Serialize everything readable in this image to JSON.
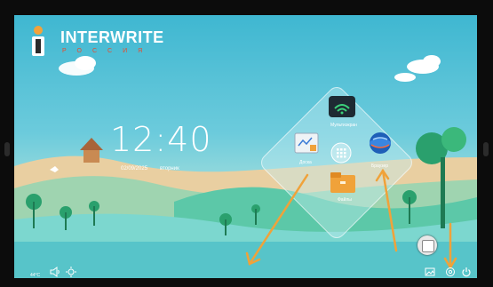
{
  "brand": {
    "name": "INTERWRITE",
    "sub": "РОССИЯ"
  },
  "clock": {
    "time": "12:40",
    "date": "02/09/2025",
    "weekday": "вторник"
  },
  "launcher": {
    "items": [
      {
        "label": "Мультиэкран",
        "icon": "multiscreen-icon"
      },
      {
        "label": "Доска",
        "icon": "whiteboard-icon"
      },
      {
        "label": "Браузер",
        "icon": "browser-icon"
      },
      {
        "label": "Файлы",
        "icon": "files-icon"
      }
    ],
    "center_icon": "apps-grid-icon"
  },
  "status": {
    "temperature": "44°C"
  },
  "colors": {
    "brand_red": "#e94a2c",
    "accent_arrow": "#f0a23a",
    "sky": "#3fb7d1"
  },
  "icons": [
    "sound-icon",
    "brightness-icon",
    "gallery-icon",
    "settings-icon",
    "power-icon",
    "touch-float-icon"
  ]
}
